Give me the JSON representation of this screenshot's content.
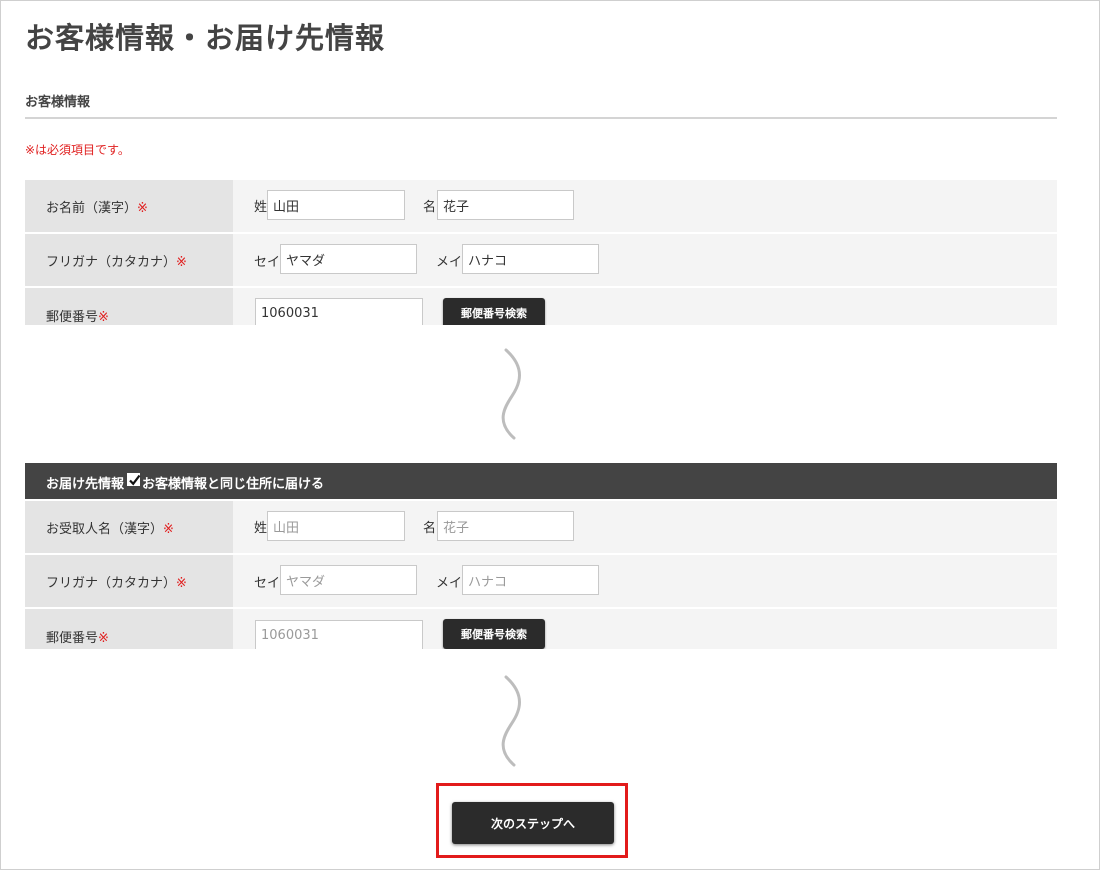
{
  "page": {
    "title": "お客様情報・お届け先情報"
  },
  "customer": {
    "section_title": "お客様情報",
    "required_note": "※は必須項目です。",
    "required_mark": "※",
    "name": {
      "label": "お名前（漢字）",
      "last_prefix": "姓",
      "last_value": "山田",
      "first_prefix": "名",
      "first_value": "花子"
    },
    "kana": {
      "label": "フリガナ（カタカナ）",
      "last_prefix": "セイ",
      "last_value": "ヤマダ",
      "first_prefix": "メイ",
      "first_value": "ハナコ"
    },
    "postal": {
      "label": "郵便番号",
      "value": "1060031",
      "button": "郵便番号検索"
    }
  },
  "delivery": {
    "section_title": "お届け先情報",
    "same_as_customer_label": "お客様情報と同じ住所に届ける",
    "same_as_customer_checked": true,
    "required_mark": "※",
    "name": {
      "label": "お受取人名（漢字）",
      "last_prefix": "姓",
      "last_value": "山田",
      "first_prefix": "名",
      "first_value": "花子"
    },
    "kana": {
      "label": "フリガナ（カタカナ）",
      "last_prefix": "セイ",
      "last_value": "ヤマダ",
      "first_prefix": "メイ",
      "first_value": "ハナコ"
    },
    "postal": {
      "label": "郵便番号",
      "value": "1060031",
      "button": "郵便番号検索"
    }
  },
  "actions": {
    "next_button": "次のステップへ"
  },
  "colors": {
    "required": "#e02020",
    "header_bg": "#444444",
    "button_bg": "#2b2b2b",
    "highlight": "#e21b1b"
  }
}
